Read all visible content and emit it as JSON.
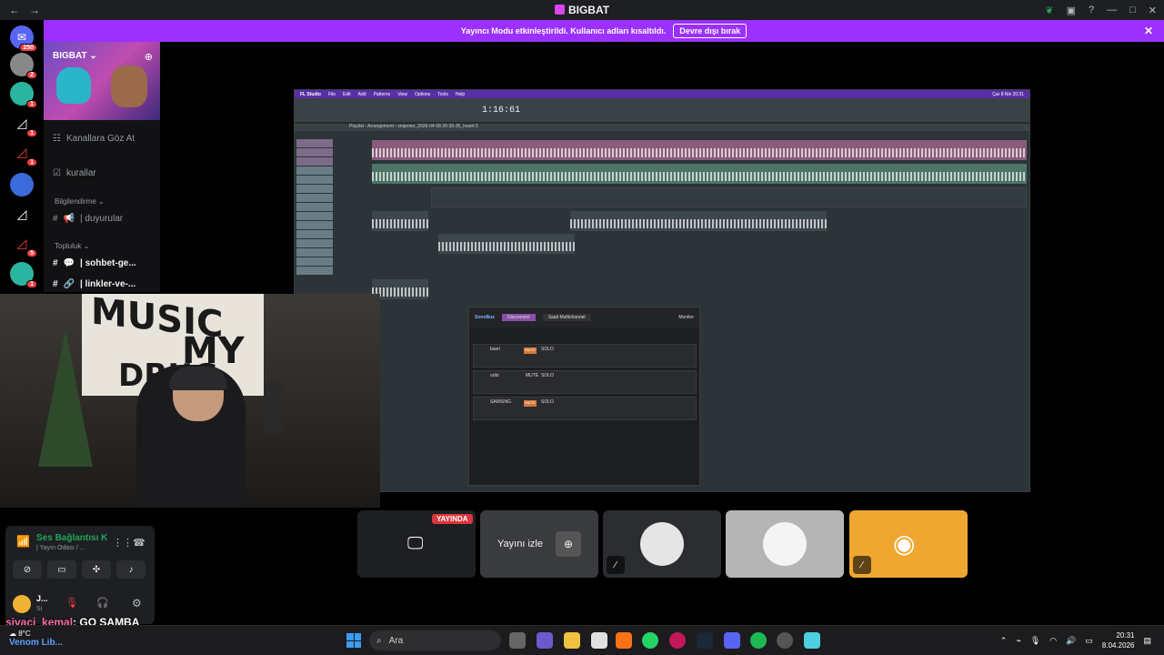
{
  "window": {
    "title": "BIGBAT",
    "nav_back": "←",
    "nav_fwd": "→",
    "controls": [
      "—",
      "□",
      "✕"
    ]
  },
  "banner": {
    "message": "Yayıncı Modu etkinleştirildi. Kullanıcı adları kısaltıldı.",
    "button": "Devre dışı bırak",
    "close": "✕"
  },
  "server_badges": {
    "dm": "250",
    "s1": "2",
    "s2": "1",
    "s3": "1",
    "s4": "1",
    "s5": "1",
    "s6": "5",
    "s7": "1"
  },
  "guild": {
    "name": "BIGBAT",
    "chevron": "⌄"
  },
  "channels": {
    "browse": "Kanallara Göz At",
    "rules": "kurallar",
    "cat_info": "Bilgilendirme",
    "announcements": "| duyurular",
    "cat_community": "Topluluk",
    "chat": "| sohbet-ge...",
    "links": "| linkler-ve-..."
  },
  "fl": {
    "menu": [
      "FL Studio",
      "File",
      "Edit",
      "Add",
      "Patterns",
      "View",
      "Options",
      "Tools",
      "Help"
    ],
    "time": "1:16:61",
    "playlist_title": "Playlist - Arrangement › zmjentor_2026-04-08 20-39-35_Insert 5",
    "mac_clock": "Çar 8 Nis 20:31"
  },
  "sonobus": {
    "app": "SonoBus",
    "group": "Saati Multichannel",
    "rows": [
      "basri",
      "oobi",
      "SAMSING"
    ],
    "mute": "MUTE",
    "solo": "SOLO",
    "monitor": "Monitor",
    "disconnect": "Disconnect"
  },
  "stage": {
    "live_badge": "YAYINDA",
    "watch_label": "Yayını izle"
  },
  "voice": {
    "title": "Ses Bağlantısı K",
    "subtitle": "| Yayın Odası / ..."
  },
  "user": {
    "name": "J...",
    "status": "Si"
  },
  "chat_overlay": {
    "user": "sivaci_kemal",
    "message": ": GO SAMBA"
  },
  "taskbar": {
    "weather": "8°C",
    "weather_sub": "Venom Lib...",
    "search": "Ara",
    "time": "20:31",
    "date": "8.04.2026"
  },
  "colors": {
    "accent": "#9b30ff",
    "discord_blurple": "#5865f2",
    "tile_orange": "#f0a732",
    "live_red": "#da373c"
  }
}
